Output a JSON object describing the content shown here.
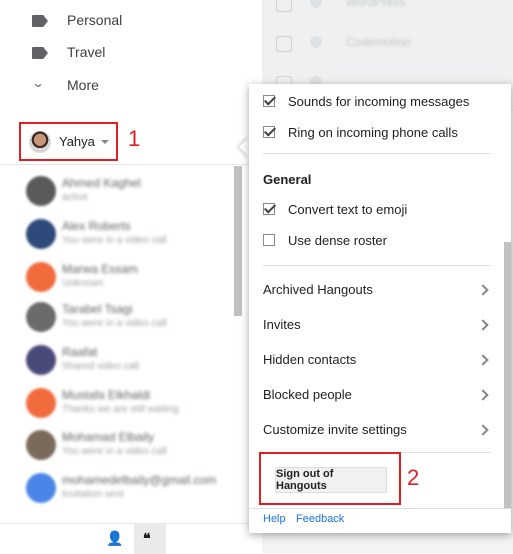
{
  "nav": {
    "items": [
      {
        "label": "Personal",
        "icon": "label-icon"
      },
      {
        "label": "Travel",
        "icon": "label-icon"
      },
      {
        "label": "More",
        "icon": "chevron-down-icon"
      }
    ]
  },
  "hangouts": {
    "user_name": "Yahya",
    "step_markers": [
      "1",
      "2"
    ]
  },
  "settings": {
    "options": [
      {
        "label": "Sounds for incoming messages",
        "checked": true
      },
      {
        "label": "Ring on incoming phone calls",
        "checked": true
      }
    ],
    "general_title": "General",
    "general_options": [
      {
        "label": "Convert text to emoji",
        "checked": true
      },
      {
        "label": "Use dense roster",
        "checked": false
      }
    ],
    "menu": [
      "Archived Hangouts",
      "Invites",
      "Hidden contacts",
      "Blocked people",
      "Customize invite settings"
    ],
    "sign_out_label": "Sign out of Hangouts",
    "footer": {
      "help": "Help",
      "feedback": "Feedback"
    }
  },
  "colors": {
    "highlight": "#e02020",
    "link": "#1a73e8"
  }
}
